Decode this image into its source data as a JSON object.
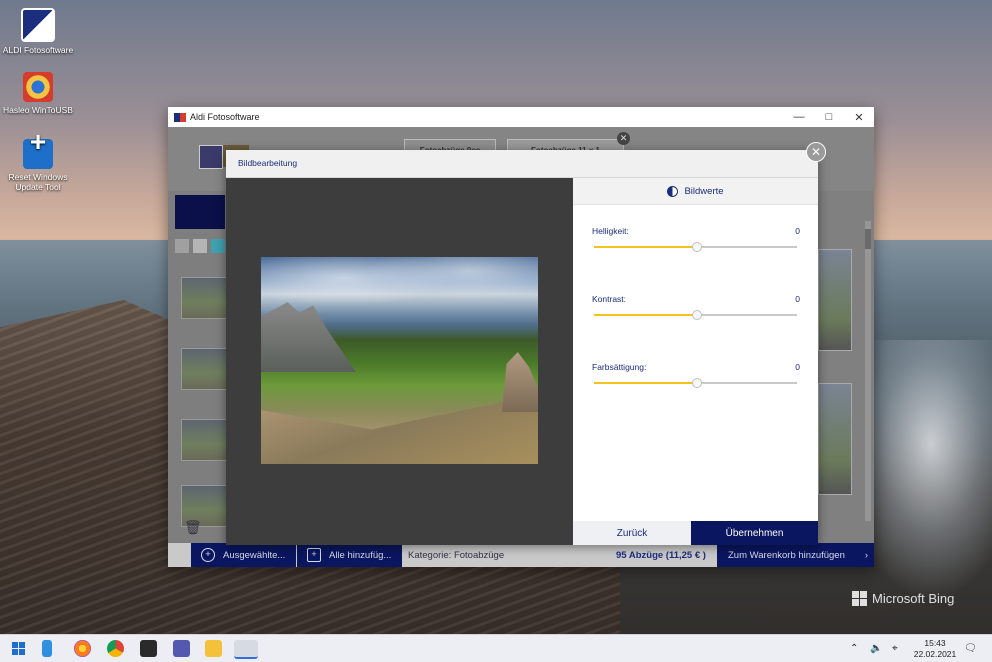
{
  "desktop": {
    "icons": [
      {
        "label": "ALDI Fotosoftware"
      },
      {
        "label": "Hasleo WinToUSB"
      },
      {
        "label": "Reset Windows Update Tool"
      }
    ],
    "watermark": "Microsoft Bing"
  },
  "app": {
    "title": "Aldi Fotosoftware",
    "tabs": [
      "Fotoabzüge 9cc",
      "Fotoabzüge 11 x 1"
    ],
    "bottom_bar": {
      "add_selected": "Ausgewählte...",
      "add_all": "Alle hinzufüg...",
      "category": "Kategorie: Fotoabzüge",
      "summary": "95 Abzüge (11,25 € )",
      "cart": "Zum Warenkorb hinzufügen"
    }
  },
  "dialog": {
    "title": "Bildbearbeitung",
    "panel_title": "Bildwerte",
    "sliders": [
      {
        "label": "Helligkeit:",
        "value": "0",
        "level": 0.5
      },
      {
        "label": "Kontrast:",
        "value": "0",
        "level": 0.5
      },
      {
        "label": "Farbsättigung:",
        "value": "0",
        "level": 0.5
      }
    ],
    "back_label": "Zurück",
    "apply_label": "Übernehmen"
  },
  "taskbar": {
    "time": "15:43",
    "date": "22.02.2021"
  },
  "colors": {
    "navy": "#0b1660",
    "accent_yellow": "#f4c21d",
    "text_blue": "#1b2d7d"
  }
}
